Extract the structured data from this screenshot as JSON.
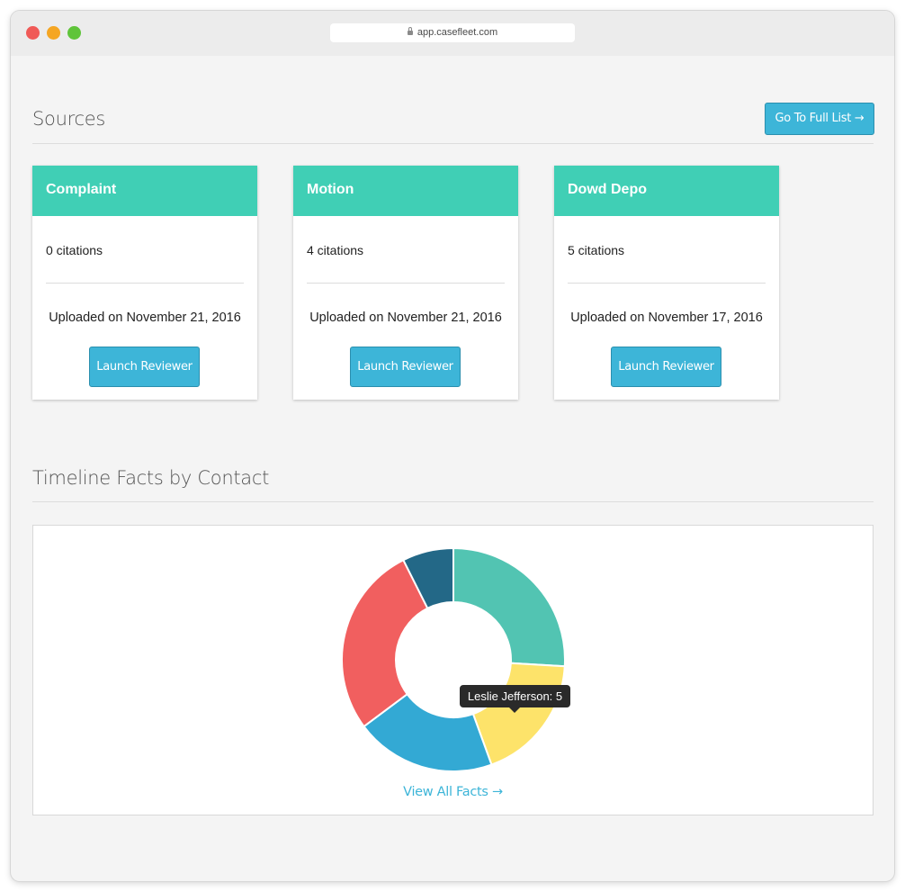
{
  "browser": {
    "url": "app.casefleet.com"
  },
  "sources": {
    "title": "Sources",
    "full_list_label": "Go To Full List →",
    "cards": [
      {
        "name": "Complaint",
        "citations": "0 citations",
        "uploaded": "Uploaded on November 21, 2016",
        "button": "Launch Reviewer"
      },
      {
        "name": "Motion",
        "citations": "4 citations",
        "uploaded": "Uploaded on November 21, 2016",
        "button": "Launch Reviewer"
      },
      {
        "name": "Dowd Depo",
        "citations": "5 citations",
        "uploaded": "Uploaded on November 17, 2016",
        "button": "Launch Reviewer"
      }
    ]
  },
  "timeline": {
    "title": "Timeline Facts by Contact",
    "view_all_label": "View All Facts →",
    "tooltip": "Leslie Jefferson: 5"
  },
  "chart_data": {
    "type": "pie",
    "donut": true,
    "series": [
      {
        "value": 7,
        "color": "#52c4b2"
      },
      {
        "label": "Leslie Jefferson",
        "value": 5,
        "color": "#fde36a"
      },
      {
        "value": 5.5,
        "color": "#33a9d4"
      },
      {
        "value": 7.5,
        "color": "#f15f5f"
      },
      {
        "value": 2,
        "color": "#236887"
      }
    ]
  },
  "colors": {
    "accent": "#3db5d8",
    "card_header": "#40cfb5"
  }
}
